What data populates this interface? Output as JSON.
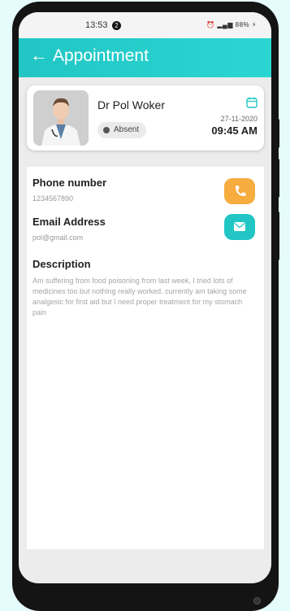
{
  "status_bar": {
    "time": "13:53",
    "notification_count": "2",
    "battery": "88%"
  },
  "appbar": {
    "title": "Appointment"
  },
  "doctor": {
    "name": "Dr Pol Woker",
    "status": "Absent",
    "date": "27-11-2020",
    "time": "09:45 AM"
  },
  "contact": {
    "phone_label": "Phone number",
    "phone_value": "1234567890",
    "email_label": "Email Address",
    "email_value": "pol@gmail.com"
  },
  "description": {
    "label": "Description",
    "text": "Am suffering from food poisoning from last week, I tried lots of medicines too but nothing really worked. currently am taking some analgesic for first aid but I need proper treatment for my stomach pain"
  },
  "colors": {
    "accent": "#21c6c4",
    "call_button": "#f6ac3e",
    "email_button": "#21c6c4"
  }
}
